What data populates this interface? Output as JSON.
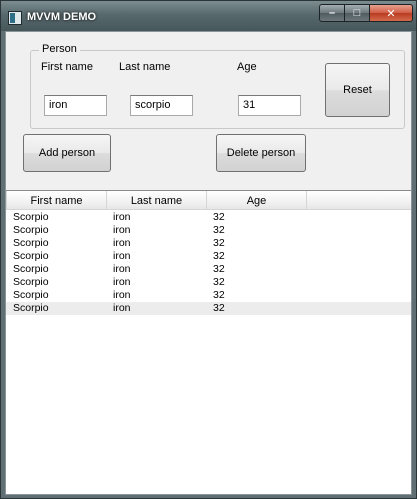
{
  "window": {
    "title": "MVVM DEMO"
  },
  "caption_buttons": {
    "minimize": "–",
    "maximize": "□",
    "close": "✕"
  },
  "form": {
    "group_title": "Person",
    "labels": {
      "first_name": "First name",
      "last_name": "Last name",
      "age": "Age"
    },
    "values": {
      "first_name": "iron",
      "last_name": "scorpio",
      "age": "31"
    },
    "reset_label": "Reset",
    "add_label": "Add person",
    "delete_label": "Delete person"
  },
  "list": {
    "columns": [
      "First name",
      "Last name",
      "Age"
    ],
    "rows": [
      [
        "Scorpio",
        "iron",
        "32"
      ],
      [
        "Scorpio",
        "iron",
        "32"
      ],
      [
        "Scorpio",
        "iron",
        "32"
      ],
      [
        "Scorpio",
        "iron",
        "32"
      ],
      [
        "Scorpio",
        "iron",
        "32"
      ],
      [
        "Scorpio",
        "iron",
        "32"
      ],
      [
        "Scorpio",
        "iron",
        "32"
      ],
      [
        "Scorpio",
        "iron",
        "32"
      ]
    ],
    "selected_row": 7
  }
}
